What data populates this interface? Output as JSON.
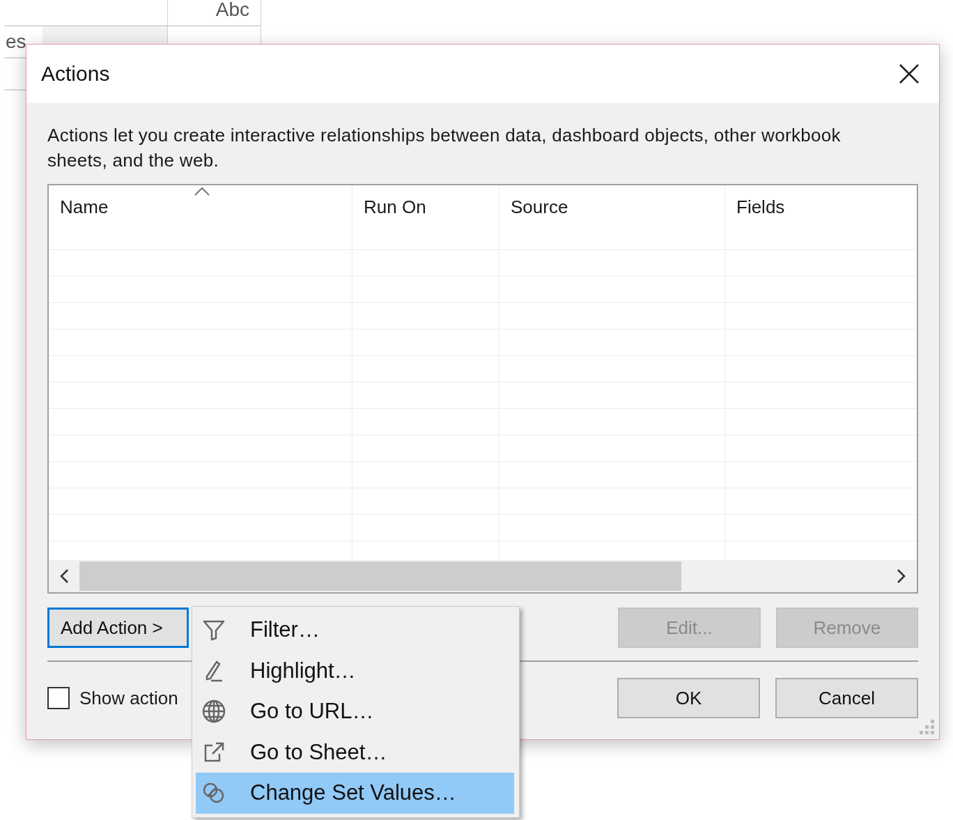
{
  "background": {
    "header_cell": "Abc",
    "row_label": "es"
  },
  "dialog": {
    "title": "Actions",
    "description": "Actions let you create interactive relationships between data, dashboard objects, other workbook sheets, and the web.",
    "table": {
      "columns": [
        {
          "label": "Name",
          "sorted": true
        },
        {
          "label": "Run On",
          "sorted": false
        },
        {
          "label": "Source",
          "sorted": false
        },
        {
          "label": "Fields",
          "sorted": false
        }
      ]
    },
    "action_buttons": [
      {
        "label": "Add Action >",
        "focused": true,
        "disabled": false
      },
      {
        "label": "Edit...",
        "focused": false,
        "disabled": true
      },
      {
        "label": "Remove",
        "focused": false,
        "disabled": true
      }
    ],
    "checkbox": {
      "label": "Show action",
      "checked": false
    },
    "footer_buttons": [
      {
        "label": "OK"
      },
      {
        "label": "Cancel"
      }
    ]
  },
  "menu": {
    "items": [
      {
        "label": "Filter…",
        "kind": "filter",
        "selected": false
      },
      {
        "label": "Highlight…",
        "kind": "highlight",
        "selected": false
      },
      {
        "label": "Go to URL…",
        "kind": "url",
        "selected": false
      },
      {
        "label": "Go to Sheet…",
        "kind": "sheet",
        "selected": false
      },
      {
        "label": "Change Set Values…",
        "kind": "set",
        "selected": true
      }
    ]
  }
}
